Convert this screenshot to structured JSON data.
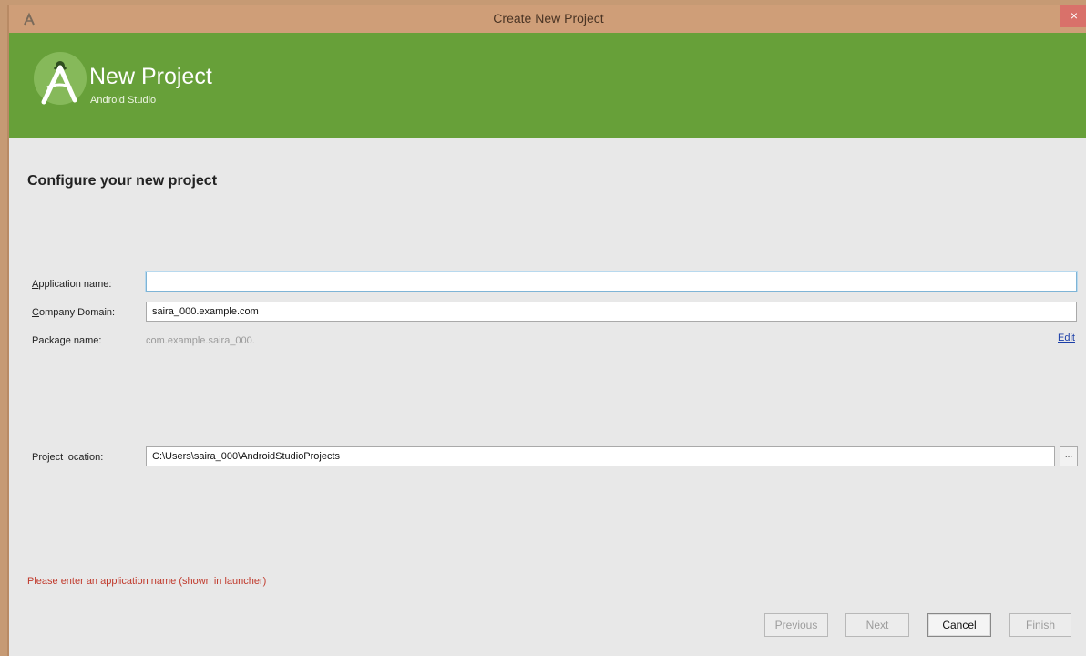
{
  "window": {
    "title": "Create New Project",
    "close_glyph": "×"
  },
  "banner": {
    "title": "New Project",
    "subtitle": "Android Studio"
  },
  "page": {
    "heading": "Configure your new project"
  },
  "form": {
    "app_name": {
      "label_u": "A",
      "label_rest": "pplication name:",
      "value": ""
    },
    "company_domain": {
      "label_u": "C",
      "label_rest": "ompany Domain:",
      "value": "saira_000.example.com"
    },
    "package_name": {
      "label": "Package name:",
      "value": "com.example.saira_000.",
      "edit": "Edit"
    },
    "project_location": {
      "label": "Project location:",
      "value": "C:\\Users\\saira_000\\AndroidStudioProjects",
      "browse": "..."
    }
  },
  "error": "Please enter an application name (shown in launcher)",
  "buttons": {
    "previous": "Previous",
    "next": "Next",
    "cancel": "Cancel",
    "finish": "Finish"
  },
  "colors": {
    "banner": "#67a039",
    "titlebar": "#cf9e78",
    "error": "#c0392b",
    "link": "#1b3ea8"
  },
  "icons": {
    "app": "android-studio-icon",
    "logo": "android-studio-logo"
  }
}
